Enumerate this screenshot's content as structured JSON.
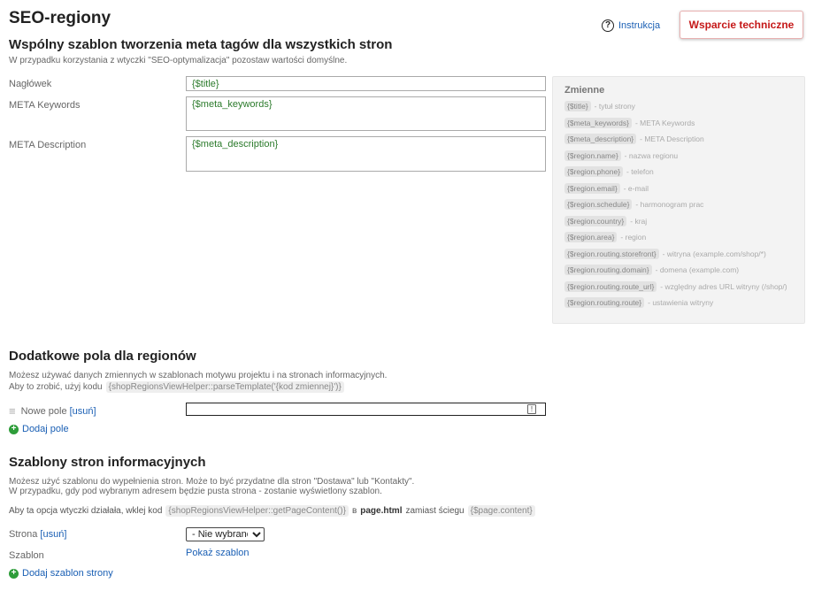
{
  "header": {
    "title": "SEO-regiony",
    "instruction_label": "Instrukcja",
    "support_label": "Wsparcie techniczne"
  },
  "meta_section": {
    "heading": "Wspólny szablon tworzenia meta tagów dla wszystkich stron",
    "note": "W przypadku korzystania z wtyczki \"SEO-optymalizacja\" pozostaw wartości domyślne.",
    "fields": [
      {
        "label": "Nagłówek",
        "value": "{$title}"
      },
      {
        "label": "META Keywords",
        "value": "{$meta_keywords}"
      },
      {
        "label": "META Description",
        "value": "{$meta_description}"
      }
    ]
  },
  "variables": {
    "title": "Zmienne",
    "items": [
      {
        "code": "{$title}",
        "desc": "- tytuł strony"
      },
      {
        "code": "{$meta_keywords}",
        "desc": "- META Keywords"
      },
      {
        "code": "{$meta_description}",
        "desc": "- META Description"
      },
      {
        "code": "{$region.name}",
        "desc": "- nazwa regionu"
      },
      {
        "code": "{$region.phone}",
        "desc": "- telefon"
      },
      {
        "code": "{$region.email}",
        "desc": "- e-mail"
      },
      {
        "code": "{$region.schedule}",
        "desc": "- harmonogram prac"
      },
      {
        "code": "{$region.country}",
        "desc": "- kraj"
      },
      {
        "code": "{$region.area}",
        "desc": "- region"
      },
      {
        "code": "{$region.routing.storefront}",
        "desc": "- witryna (example.com/shop/*)"
      },
      {
        "code": "{$region.routing.domain}",
        "desc": "- domena (example.com)"
      },
      {
        "code": "{$region.routing.route_url}",
        "desc": "- względny adres URL witryny (/shop/)"
      },
      {
        "code": "{$region.routing.route}",
        "desc": "- ustawienia witryny"
      }
    ]
  },
  "extra_fields": {
    "heading": "Dodatkowe pola dla regionów",
    "line1": "Możesz używać danych zmiennych w szablonach motywu projektu i na stronach informacyjnych.",
    "line2_prefix": "Aby to zrobić, użyj kodu",
    "line2_code": "{shopRegionsViewHelper::parseTemplate('{kod zmiennej}')}",
    "new_field_label": "Nowe pole",
    "remove_link": "[usuń]",
    "add_field": "Dodaj pole"
  },
  "info_templates": {
    "heading": "Szablony stron informacyjnych",
    "line1": "Możesz użyć szablonu do wypełnienia stron. Może to być przydatne dla stron \"Dostawa\" lub \"Kontakty\".",
    "line2": "W przypadku, gdy pod wybranym adresem będzie pusta strona - zostanie wyświetlony szablon.",
    "paste_prefix": "Aby ta opcja wtyczki działała, wklej kod",
    "paste_code": "{shopRegionsViewHelper::getPageContent()}",
    "paste_mid": "в",
    "paste_file": "page.html",
    "paste_suffix": "zamiast ściegu",
    "paste_code2": "{$page.content}",
    "page_label": "Strona",
    "page_remove": "[usuń]",
    "page_select_value": "- Nie wybrano -",
    "template_label": "Szablon",
    "show_template": "Pokaż szablon",
    "add_template": "Dodaj szablon strony"
  },
  "colors": {
    "link": "#1a5fb4",
    "support_text": "#c51818",
    "field_value": "#2a7a2a",
    "add_icon": "#2e9d3a"
  }
}
